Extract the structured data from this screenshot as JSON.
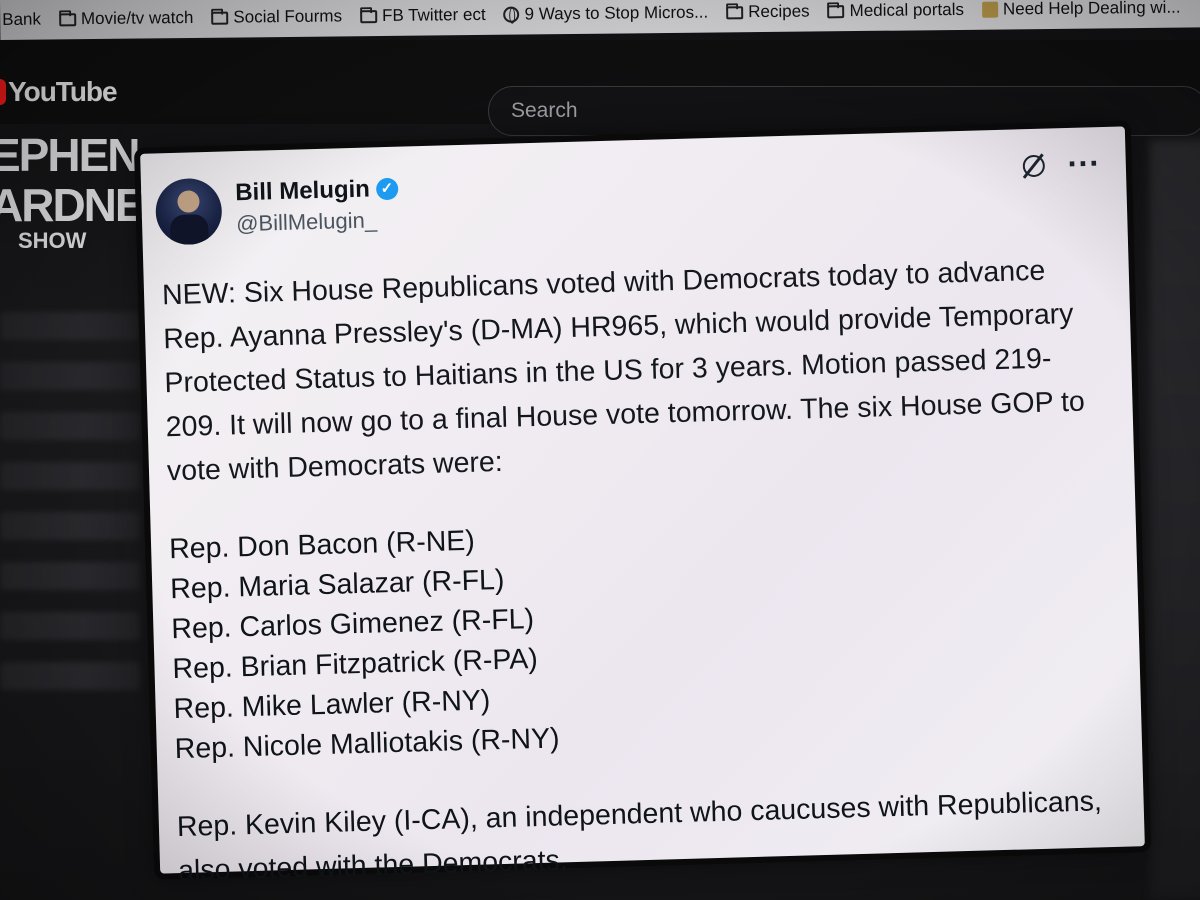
{
  "bookmarks": [
    {
      "label": "Bank",
      "icon": "none"
    },
    {
      "label": "Movie/tv watch",
      "icon": "folder-icon"
    },
    {
      "label": "Social Fourms",
      "icon": "folder-icon"
    },
    {
      "label": "FB Twitter ect",
      "icon": "folder-icon"
    },
    {
      "label": "9 Ways to Stop Micros...",
      "icon": "globe-icon"
    },
    {
      "label": "Recipes",
      "icon": "folder-icon"
    },
    {
      "label": "Medical portals",
      "icon": "folder-icon"
    },
    {
      "label": "Need Help Dealing wi...",
      "icon": "site-favicon"
    }
  ],
  "youtube": {
    "logo_text": "YouTube",
    "search_placeholder": "Search",
    "brand_color": "#ff0000"
  },
  "channel_art": {
    "line1": "EPHEN",
    "line2": "ARDNER",
    "line3": "SHOW"
  },
  "tweet": {
    "display_name": "Bill Melugin",
    "verified": true,
    "verified_color": "#1d9bf0",
    "handle": "@BillMelugin_",
    "body": "NEW: Six House Republicans voted with Democrats today to advance Rep. Ayanna Pressley's (D-MA) HR965, which would provide Temporary Protected Status to Haitians in the US for 3 years. Motion passed 219-209. It will now go to a final House vote tomorrow. The six House GOP to vote with Democrats were:",
    "reps": [
      "Rep. Don Bacon (R-NE)",
      "Rep. Maria Salazar (R-FL)",
      "Rep. Carlos Gimenez (R-FL)",
      "Rep. Brian Fitzpatrick (R-PA)",
      "Rep. Mike Lawler (R-NY)",
      "Rep. Nicole Malliotakis (R-NY)"
    ],
    "footer": "Rep. Kevin Kiley (I-CA), an independent who caucuses with Republicans, also voted with the Democrats."
  }
}
